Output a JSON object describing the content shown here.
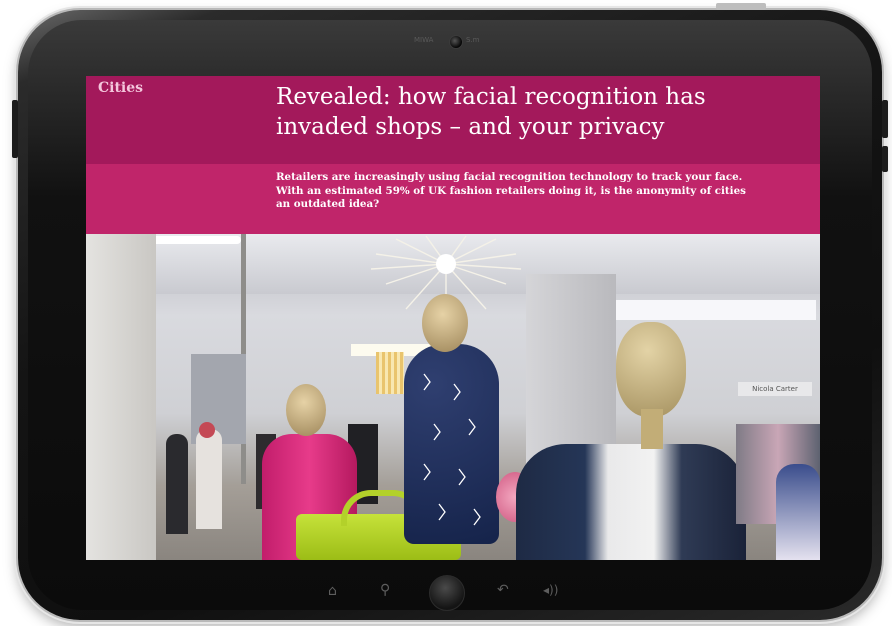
{
  "article": {
    "section": "Cities",
    "headline_line1": "Revealed: how facial recognition has",
    "headline_line2": "invaded shops – and your privacy",
    "standfirst_line1": "Retailers are increasingly using facial recognition technology to track your face.",
    "standfirst_line2": "With an estimated 59% of UK fashion retailers doing it, is the anonymity of cities",
    "standfirst_line3": "an outdated idea?"
  },
  "photo": {
    "shop_sign": "Nicola Carter"
  },
  "device": {
    "camera_left_label": "MIWA",
    "camera_right_label": "S.m",
    "nav_icons": [
      "home-icon",
      "search-icon",
      "home-button",
      "back-icon",
      "volume-icon"
    ]
  },
  "colors": {
    "header_bg": "#a3195b",
    "standfirst_bg": "#c0256a",
    "section_label": "#f4c6dc"
  }
}
